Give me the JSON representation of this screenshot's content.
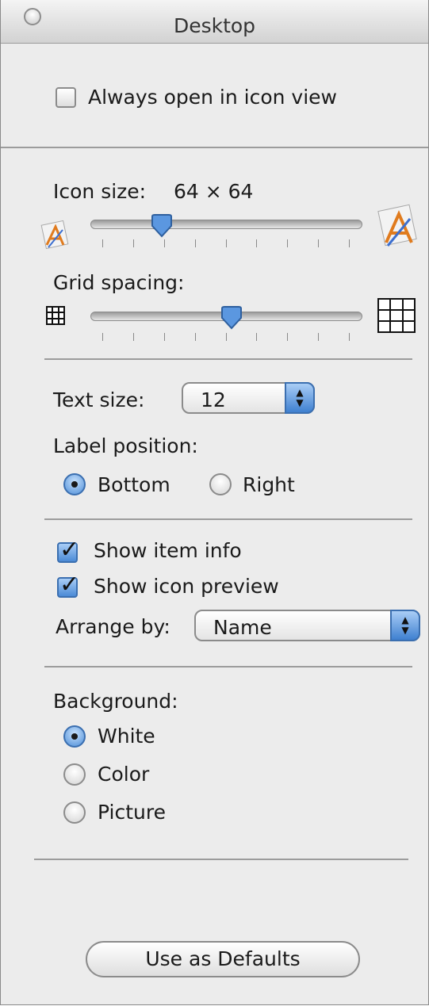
{
  "window": {
    "title": "Desktop"
  },
  "view_options": {
    "always_open_label": "Always open in icon view",
    "always_open_checked": false
  },
  "icon_size": {
    "label": "Icon size:",
    "value": "64 × 64",
    "slider_fraction": 0.24
  },
  "grid_spacing": {
    "label": "Grid spacing:",
    "slider_fraction": 0.52
  },
  "text_size": {
    "label": "Text size:",
    "value": "12"
  },
  "label_position": {
    "label": "Label position:",
    "options": [
      {
        "label": "Bottom",
        "selected": true
      },
      {
        "label": "Right",
        "selected": false
      }
    ]
  },
  "show_item_info": {
    "label": "Show item info",
    "checked": true
  },
  "show_icon_preview": {
    "label": "Show icon preview",
    "checked": true
  },
  "arrange_by": {
    "label": "Arrange by:",
    "value": "Name"
  },
  "background": {
    "label": "Background:",
    "options": [
      {
        "label": "White",
        "selected": true
      },
      {
        "label": "Color",
        "selected": false
      },
      {
        "label": "Picture",
        "selected": false
      }
    ]
  },
  "defaults_button": {
    "label": "Use as Defaults"
  },
  "colors": {
    "accent": "#4b8ad6",
    "window_bg": "#ececec",
    "separator": "#9c9c9c"
  }
}
